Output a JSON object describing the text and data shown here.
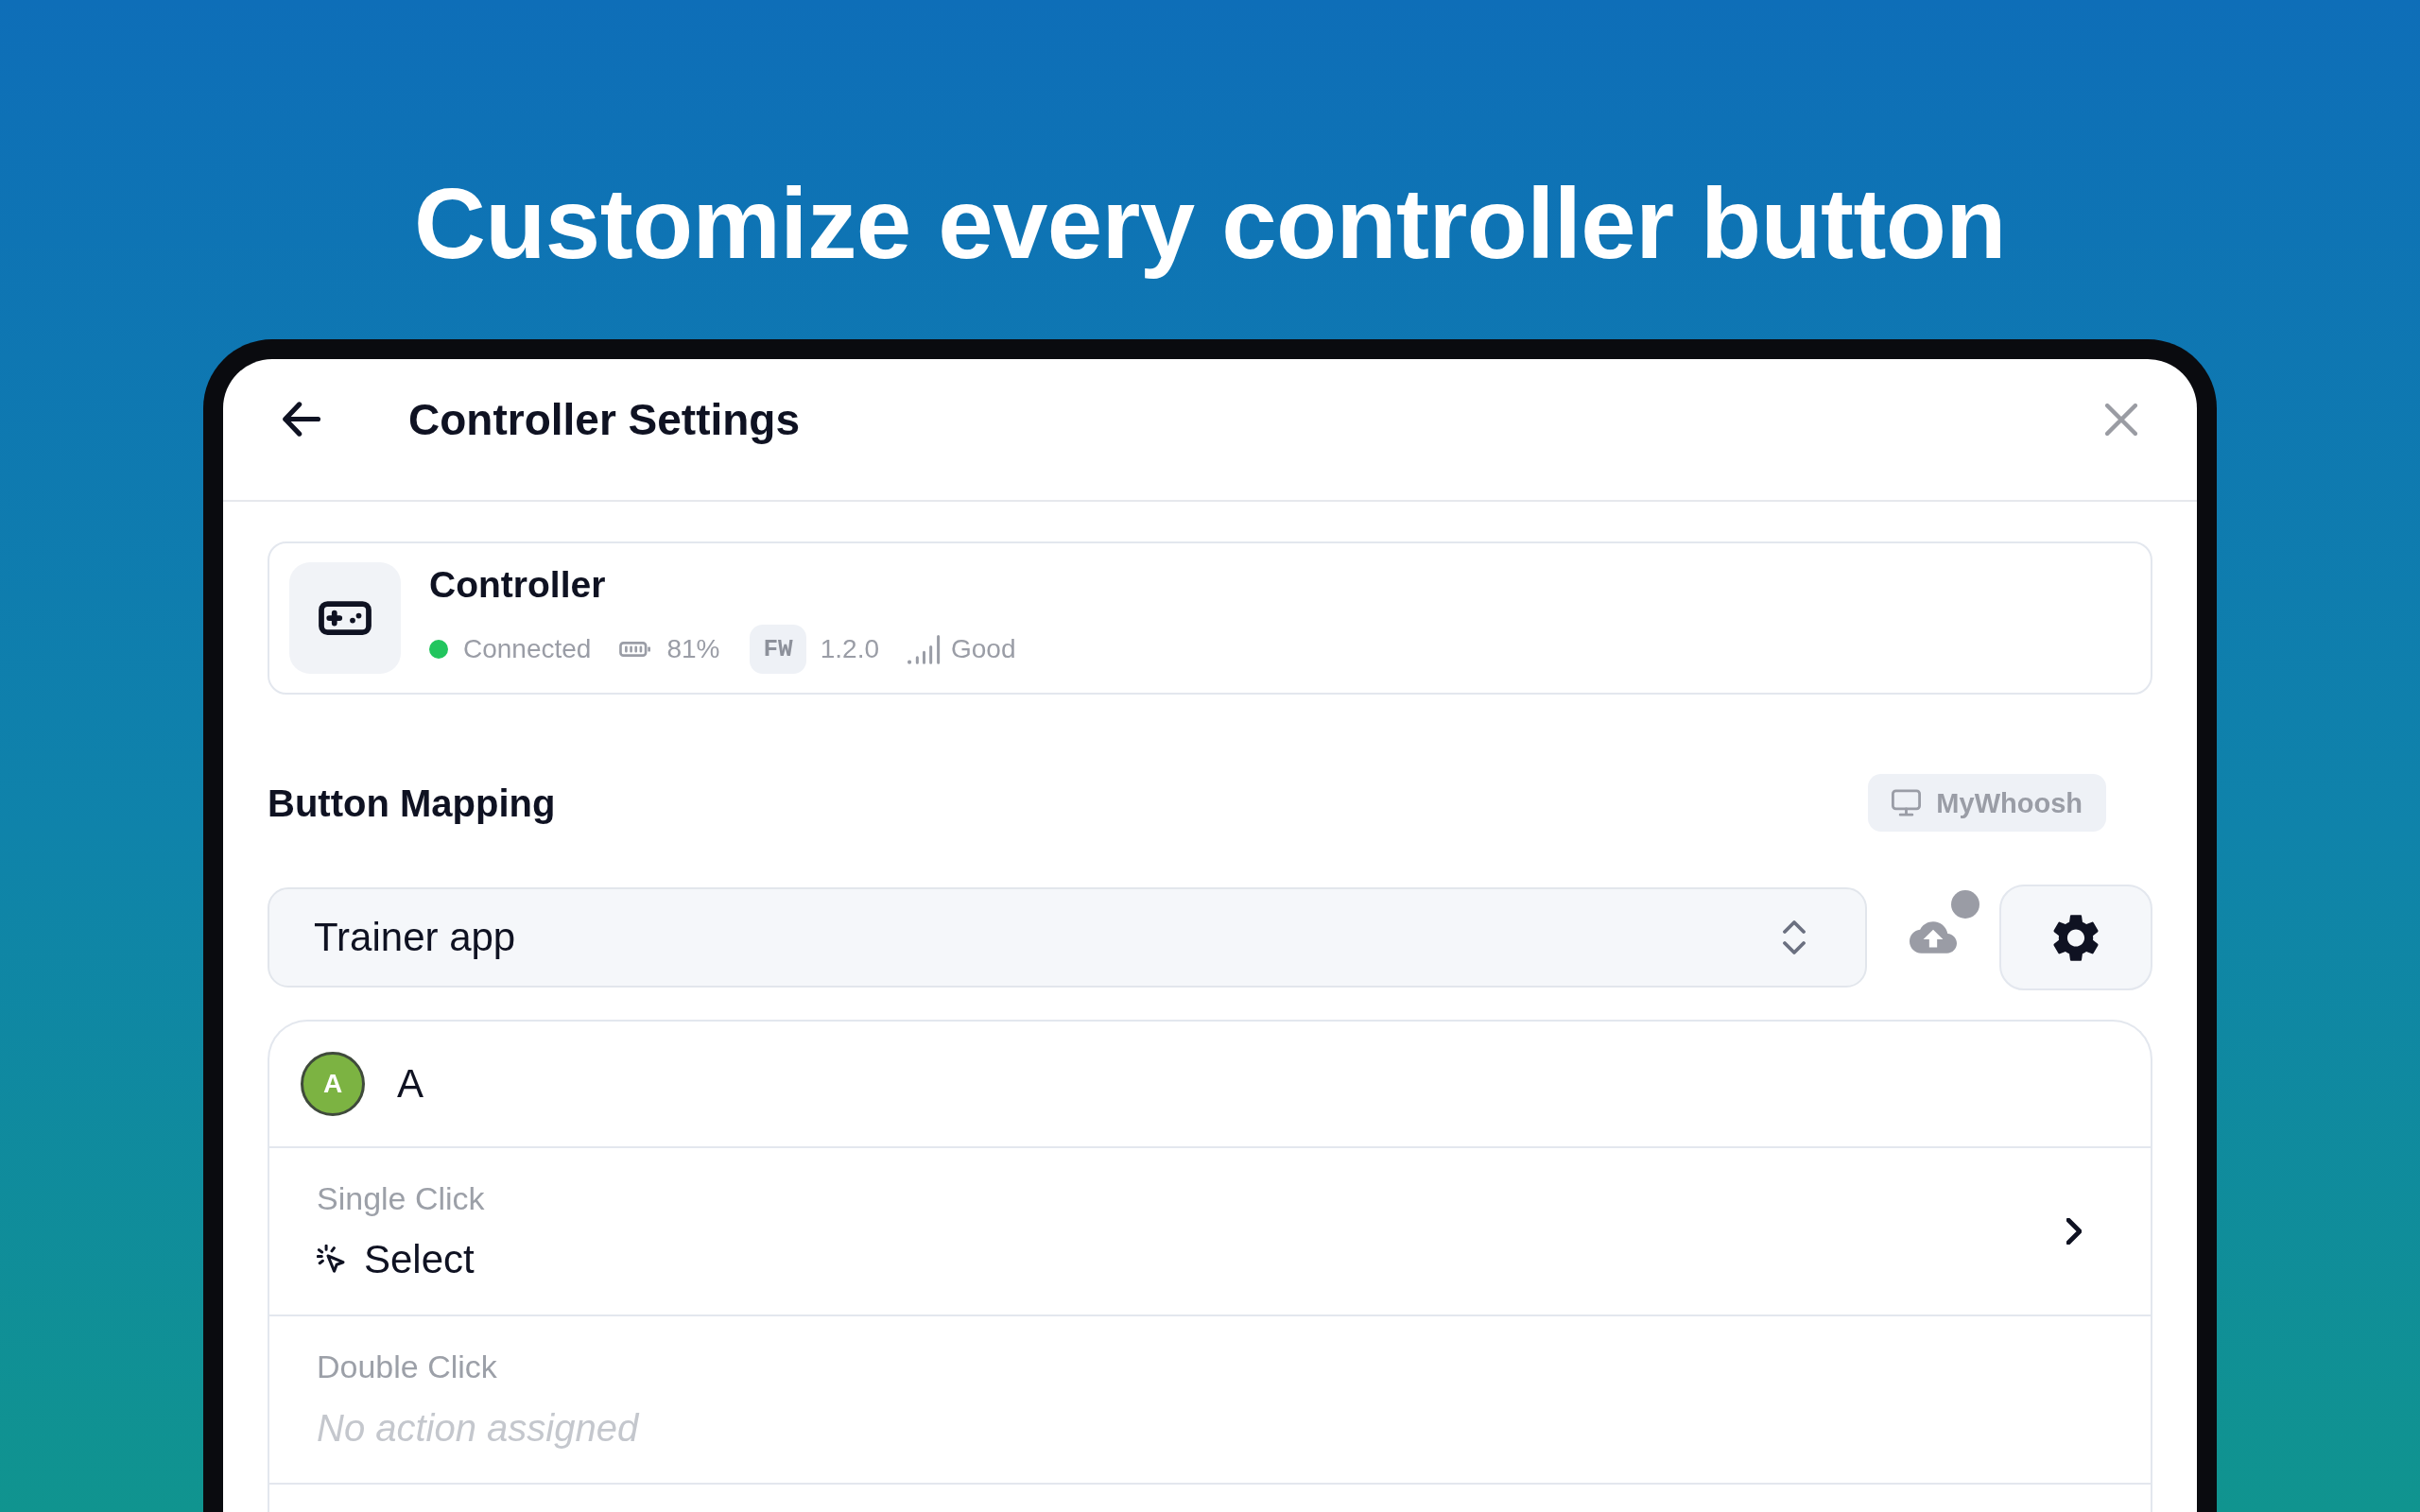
{
  "headline": "Customize every controller button",
  "window": {
    "title": "Controller Settings"
  },
  "device": {
    "name": "Controller",
    "connected": true,
    "status": "Connected",
    "battery": "81%",
    "firmware_badge": "FW",
    "firmware_version": "1.2.0",
    "signal": "Good"
  },
  "button_mapping": {
    "title": "Button Mapping",
    "target_app": "MyWhoosh",
    "profile": "Trainer app",
    "upload_indicator": true,
    "buttons": [
      {
        "badge": "A",
        "label": "A",
        "color": "#7cb342",
        "actions": [
          {
            "kind": "assigned",
            "trigger": "Single Click",
            "action": "Select"
          },
          {
            "kind": "unassigned",
            "trigger": "Double Click",
            "action": "No action assigned"
          }
        ]
      }
    ]
  }
}
